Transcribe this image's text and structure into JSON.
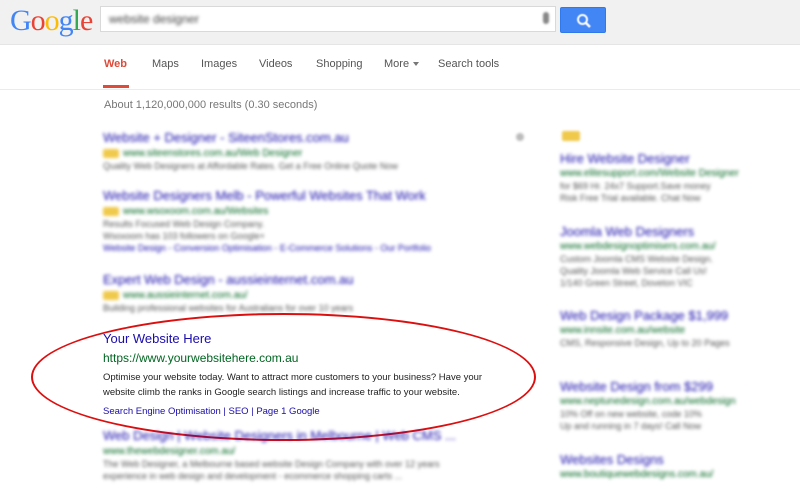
{
  "logo": {
    "letters": [
      "G",
      "o",
      "o",
      "g",
      "l",
      "e"
    ],
    "colors": [
      "#4285f4",
      "#ea4335",
      "#fbbc05",
      "#4285f4",
      "#34a853",
      "#ea4335"
    ]
  },
  "search": {
    "query": "website designer"
  },
  "tabs": [
    "Web",
    "Maps",
    "Images",
    "Videos",
    "Shopping",
    "More",
    "Search tools"
  ],
  "stats": "About 1,120,000,000 results (0.30 seconds)",
  "results_top": [
    {
      "title": "Website + Designer - SiteenStores.com.au",
      "url": "www.siteenstores.com.au/Web Designer",
      "snippet": [
        "Quality Web Designers at Affordable Rates. Get a Free Online Quote Now"
      ]
    },
    {
      "title": "Website Designers Melb - Powerful Websites That Work",
      "url": "www.wsoxoom.com.au/Websites",
      "snippet": [
        "Results Focused Web Design Company.",
        "Wsoxoom has 103 followers on Google+"
      ],
      "links": "Website Design - Conversion Optimisation - E-Commerce Solutions - Our Portfolio"
    },
    {
      "title": "Expert Web Design - aussieinternet.com.au",
      "url": "www.aussieinternet.com.au/",
      "snippet": [
        "Building professional websites for Australians for over 10 years"
      ]
    }
  ],
  "featured": {
    "title": "Your Website Here",
    "url": "https://www.yourwebsitehere.com.au",
    "snippet_line1": "Optimise your website today. Want to attract more customers to your business? Have your",
    "snippet_line2": "website climb the ranks in Google search listings and increase traffic to your website.",
    "links": "Search Engine Optimisation | SEO | Page 1 Google"
  },
  "results_bottom": [
    {
      "title": "Web Design | Website Designers in Melbourne | Web CMS ...",
      "url": "www.thewebdesigner.com.au/",
      "snippet": [
        "The Web Designer, a Melbourne based website Design Company with over 12 years",
        "experience in web design and development - ecommerce shopping carts ..."
      ]
    }
  ],
  "side_ads": [
    {
      "title": "Hire Website Designer",
      "url": "www.elitesupport.com/Website Designer",
      "snippet": [
        "for $69 Hr. 24x7 Support.Save money",
        "Risk Free Trial available. Chat Now"
      ]
    },
    {
      "title": "Joomla Web Designers",
      "url": "www.webdesignoptimisers.com.au/",
      "snippet": [
        "Custom Joomla CMS Website Design.",
        "Quality Joomla Web Service Call Us!",
        "1/140 Green Street, Doveton VIC"
      ]
    },
    {
      "title": "Web Design Package $1,999",
      "url": "www.innsite.com.au/website",
      "snippet": [
        "CMS, Responsive Design, Up to 20 Pages"
      ]
    },
    {
      "title": "Website Design from $299",
      "url": "www.neptunedesign.com.au/webdesign",
      "snippet": [
        "10% Off on new website, code 10%",
        "Up and running in 7 days! Call Now"
      ]
    },
    {
      "title": "Websites Designs",
      "url": "www.boutiquewebdesigns.com.au/",
      "snippet": []
    }
  ]
}
